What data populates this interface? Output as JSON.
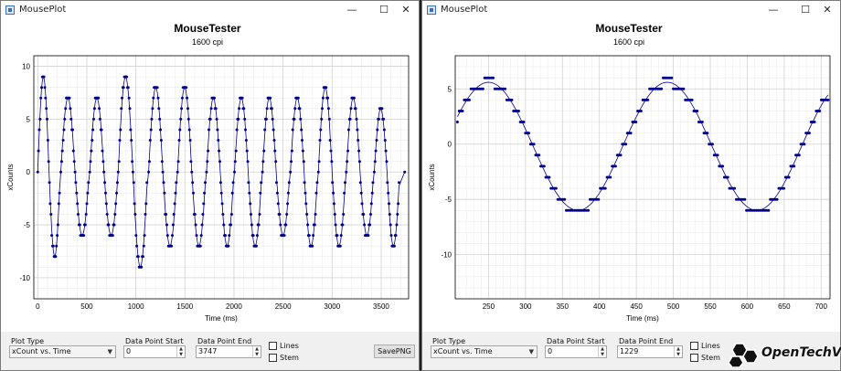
{
  "windows": [
    {
      "title": "MousePlot",
      "plot_title": "MouseTester",
      "plot_subtitle": "1600 cpi",
      "controls": {
        "plot_type_label": "Plot Type",
        "plot_type_value": "xCount vs. Time",
        "start_label": "Data Point Start",
        "start_value": "0",
        "end_label": "Data Point End",
        "end_value": "3747",
        "lines_label": "Lines",
        "stem_label": "Stem",
        "save_label": "SavePNG"
      }
    },
    {
      "title": "MousePlot",
      "plot_title": "MouseTester",
      "plot_subtitle": "1600 cpi",
      "controls": {
        "plot_type_label": "Plot Type",
        "plot_type_value": "xCount vs. Time",
        "start_label": "Data Point Start",
        "start_value": "0",
        "end_label": "Data Point End",
        "end_value": "1229",
        "lines_label": "Lines",
        "stem_label": "Stem"
      }
    }
  ],
  "window_buttons": {
    "minimize": "—",
    "maximize": "☐",
    "close": "✕"
  },
  "watermark": "OpenTechView",
  "colors": {
    "series": "#00008b",
    "grid": "#d8d8d8",
    "major_grid": "#e6e6e6"
  },
  "chart_data": [
    {
      "type": "scatter",
      "title": "MouseTester",
      "subtitle": "1600 cpi",
      "xlabel": "Time (ms)",
      "ylabel": "xCounts",
      "xlim": [
        -40,
        3780
      ],
      "ylim": [
        -12,
        11
      ],
      "xticks": [
        0,
        500,
        1000,
        1500,
        2000,
        2500,
        3000,
        3500
      ],
      "yticks": [
        -10,
        -5,
        0,
        5,
        10
      ],
      "grid": true,
      "series": [
        {
          "points_style": "dots",
          "trend_line": true,
          "cycles": [
            {
              "t0": 0,
              "peak": 9,
              "trough": -8,
              "period": 230
            },
            {
              "t0": 235,
              "peak": 7,
              "trough": -6,
              "period": 290
            },
            {
              "t0": 530,
              "peak": 7,
              "trough": -6,
              "period": 290
            },
            {
              "t0": 820,
              "peak": 9,
              "trough": -9,
              "period": 300
            },
            {
              "t0": 1130,
              "peak": 8,
              "trough": -7,
              "period": 290
            },
            {
              "t0": 1425,
              "peak": 8,
              "trough": -7,
              "period": 290
            },
            {
              "t0": 1720,
              "peak": 7,
              "trough": -7,
              "period": 280
            },
            {
              "t0": 2005,
              "peak": 7,
              "trough": -7,
              "period": 280
            },
            {
              "t0": 2290,
              "peak": 7,
              "trough": -6,
              "period": 280
            },
            {
              "t0": 2575,
              "peak": 7,
              "trough": -7,
              "period": 280
            },
            {
              "t0": 2860,
              "peak": 8,
              "trough": -7,
              "period": 280
            },
            {
              "t0": 3145,
              "peak": 7,
              "trough": -6,
              "period": 280
            },
            {
              "t0": 3430,
              "peak": 6,
              "trough": -7,
              "period": 260
            }
          ],
          "x_end": 3740
        }
      ]
    },
    {
      "type": "scatter",
      "title": "MouseTester",
      "subtitle": "1600 cpi",
      "xlabel": "Time (ms)",
      "ylabel": "xCounts",
      "xlim": [
        205,
        712
      ],
      "ylim": [
        -14,
        8
      ],
      "xticks": [
        250,
        300,
        350,
        400,
        450,
        500,
        550,
        600,
        650,
        700
      ],
      "yticks": [
        -10,
        -5,
        0,
        5
      ],
      "grid": true,
      "series": [
        {
          "points_style": "dots",
          "trend_line": true,
          "model": {
            "amplitude": 5.8,
            "offset": -0.2,
            "period": 242,
            "peak_at": 250
          },
          "x_start": 208,
          "x_end": 710
        }
      ]
    }
  ]
}
